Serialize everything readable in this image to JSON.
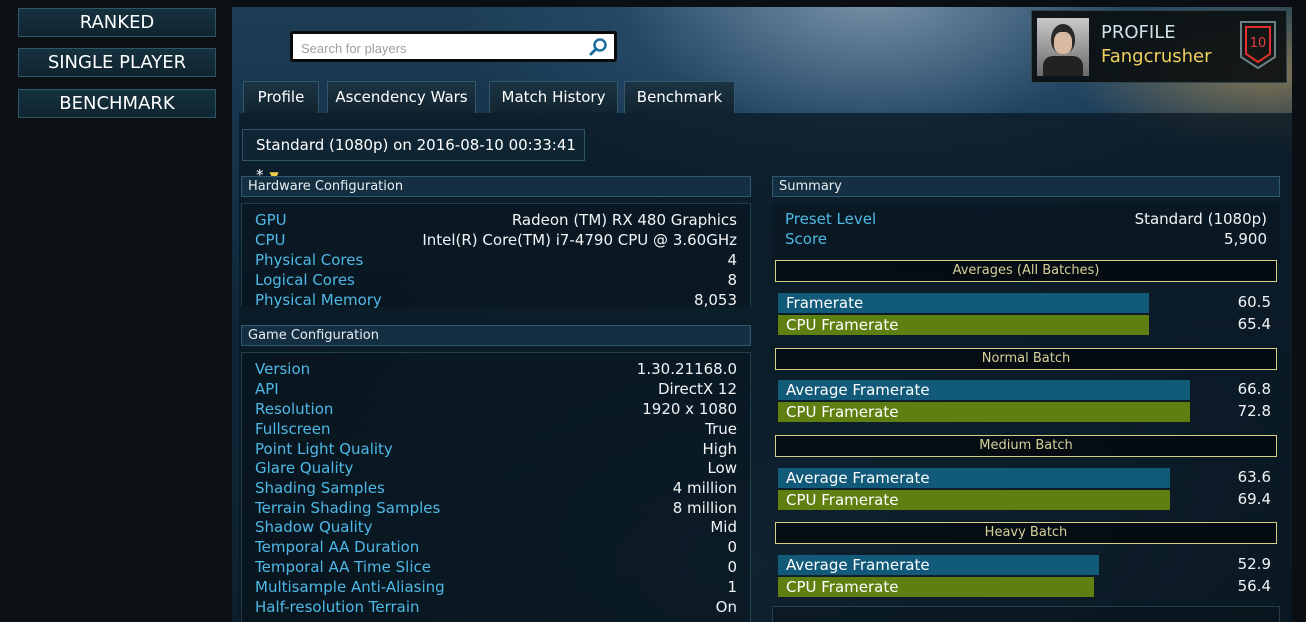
{
  "leftnav": {
    "items": [
      {
        "label": "RANKED"
      },
      {
        "label": "SINGLE PLAYER"
      },
      {
        "label": "BENCHMARK"
      }
    ]
  },
  "search": {
    "placeholder": "Search for players",
    "value": ""
  },
  "tabs": [
    {
      "label": "Profile"
    },
    {
      "label": "Ascendency Wars"
    },
    {
      "label": "Match History"
    },
    {
      "label": "Benchmark"
    }
  ],
  "profile": {
    "title": "PROFILE",
    "name": "Fangcrusher",
    "level": "10"
  },
  "selector": {
    "value": "Standard (1080p) on 2016-08-10 00:33:41 *"
  },
  "hardware": {
    "title": "Hardware Configuration",
    "rows": [
      {
        "key": "GPU",
        "value": "Radeon (TM) RX 480 Graphics"
      },
      {
        "key": "CPU",
        "value": "Intel(R) Core(TM) i7-4790 CPU @ 3.60GHz"
      },
      {
        "key": "Physical Cores",
        "value": "4"
      },
      {
        "key": "Logical Cores",
        "value": "8"
      },
      {
        "key": "Physical Memory",
        "value": "8,053"
      }
    ]
  },
  "game": {
    "title": "Game Configuration",
    "rows": [
      {
        "key": "Version",
        "value": "1.30.21168.0"
      },
      {
        "key": "API",
        "value": "DirectX 12"
      },
      {
        "key": "Resolution",
        "value": "1920 x 1080"
      },
      {
        "key": "Fullscreen",
        "value": "True"
      },
      {
        "key": "Point Light Quality",
        "value": "High"
      },
      {
        "key": "Glare Quality",
        "value": "Low"
      },
      {
        "key": "Shading Samples",
        "value": "4 million"
      },
      {
        "key": "Terrain Shading Samples",
        "value": "8 million"
      },
      {
        "key": "Shadow Quality",
        "value": "Mid"
      },
      {
        "key": "Temporal AA Duration",
        "value": "0"
      },
      {
        "key": "Temporal AA Time Slice",
        "value": "0"
      },
      {
        "key": "Multisample Anti-Aliasing",
        "value": "1"
      },
      {
        "key": "Half-resolution Terrain",
        "value": "On"
      }
    ]
  },
  "summary": {
    "title": "Summary",
    "rows": [
      {
        "key": "Preset Level",
        "value": "Standard (1080p)"
      },
      {
        "key": "Score",
        "value": "5,900"
      }
    ],
    "groups": [
      {
        "title": "Averages (All Batches)",
        "bars": [
          {
            "label": "Framerate",
            "value": "60.5",
            "fraction": 0.74
          },
          {
            "label": "CPU Framerate",
            "value": "65.4",
            "fraction": 0.74
          }
        ]
      },
      {
        "title": "Normal Batch",
        "bars": [
          {
            "label": "Average Framerate",
            "value": "66.8",
            "fraction": 0.82
          },
          {
            "label": "CPU Framerate",
            "value": "72.8",
            "fraction": 0.82
          }
        ]
      },
      {
        "title": "Medium Batch",
        "bars": [
          {
            "label": "Average Framerate",
            "value": "63.6",
            "fraction": 0.78
          },
          {
            "label": "CPU Framerate",
            "value": "69.4",
            "fraction": 0.78
          }
        ]
      },
      {
        "title": "Heavy Batch",
        "bars": [
          {
            "label": "Average Framerate",
            "value": "52.9",
            "fraction": 0.64
          },
          {
            "label": "CPU Framerate",
            "value": "56.4",
            "fraction": 0.63
          }
        ]
      }
    ]
  },
  "colors": {
    "accent_blue": "#4fb8e6",
    "framerate_bar": "#125a7a",
    "cpu_bar": "#5f7f10",
    "profile_name": "#f0d060",
    "level_badge": "#e03030"
  },
  "icons": [
    "search-icon",
    "level-badge-icon"
  ]
}
